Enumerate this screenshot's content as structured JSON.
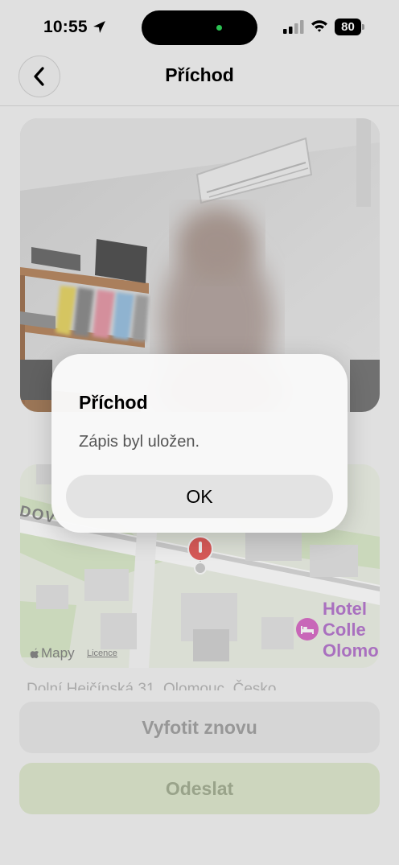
{
  "status_bar": {
    "time": "10:55",
    "battery": "80"
  },
  "nav": {
    "title": "Příchod"
  },
  "map": {
    "street_label": "DOV",
    "hotel_label": "Hotel\nColle\nOlomo",
    "attribution": "Mapy",
    "license": "Licence"
  },
  "address": "Dolní Hejčínská 31, Olomouc, Česko",
  "buttons": {
    "retake": "Vyfotit znovu",
    "send": "Odeslat"
  },
  "alert": {
    "title": "Příchod",
    "message": "Zápis byl uložen.",
    "ok": "OK"
  },
  "colors": {
    "accent_green": "#dfe9cf",
    "island_dot": "#2fd25a",
    "hotel_pin": "#d96fc8",
    "map_pin": "#e8615f"
  }
}
